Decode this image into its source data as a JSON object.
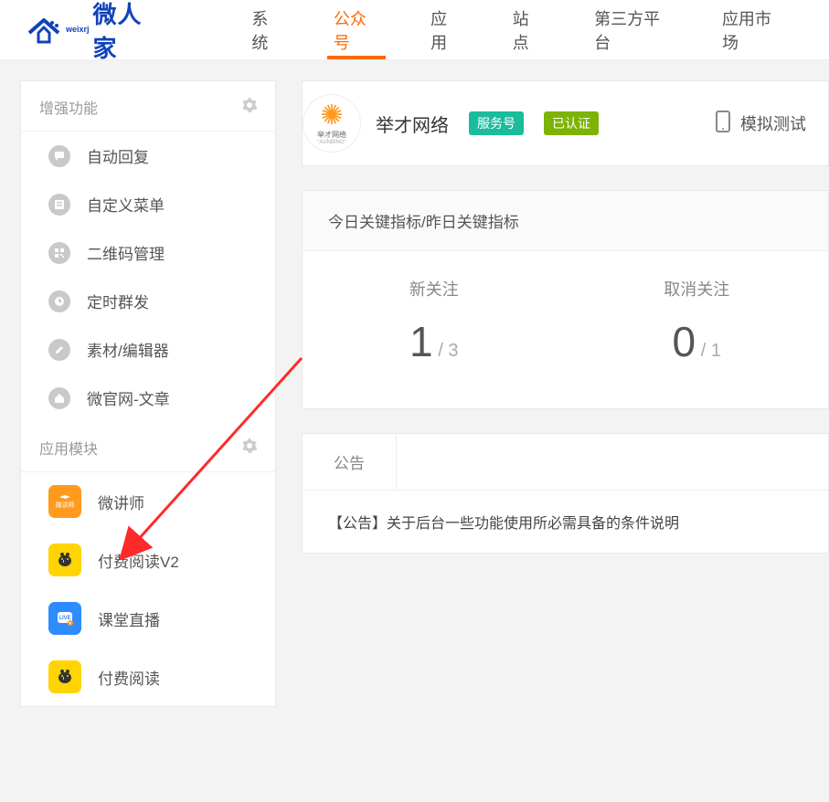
{
  "logo": {
    "brand": "微人家",
    "sub": "weixrj"
  },
  "nav": {
    "items": [
      {
        "label": "系统"
      },
      {
        "label": "公众号",
        "active": true
      },
      {
        "label": "应用"
      },
      {
        "label": "站点"
      },
      {
        "label": "第三方平台"
      },
      {
        "label": "应用市场"
      }
    ]
  },
  "account": {
    "name": "举才网络",
    "badge_service": "服务号",
    "badge_verified": "已认证",
    "logo_caption_top": "举才网络",
    "logo_caption_bottom": "\"AUNBING\""
  },
  "sim_test": "模拟测试",
  "sidebar": {
    "section_enhance": "增强功能",
    "section_apps": "应用模块",
    "items": [
      {
        "label": "自动回复"
      },
      {
        "label": "自定义菜单"
      },
      {
        "label": "二维码管理"
      },
      {
        "label": "定时群发"
      },
      {
        "label": "素材/编辑器"
      },
      {
        "label": "微官网-文章"
      }
    ],
    "apps": [
      {
        "label": "微讲师",
        "icon_text": "微讲师",
        "color": "#ff9a1f"
      },
      {
        "label": "付费阅读V2",
        "icon_text": "",
        "color": "#ffd400"
      },
      {
        "label": "课堂直播",
        "icon_text": "LIVE",
        "color": "#2f8cff"
      },
      {
        "label": "付费阅读",
        "icon_text": "",
        "color": "#ffd400"
      }
    ]
  },
  "metrics": {
    "title": "今日关键指标/昨日关键指标",
    "cols": [
      {
        "label": "新关注",
        "today": "1",
        "yesterday": "3"
      },
      {
        "label": "取消关注",
        "today": "0",
        "yesterday": "1"
      }
    ]
  },
  "notice": {
    "tab": "公告",
    "text": "【公告】关于后台一些功能使用所必需具备的条件说明"
  }
}
